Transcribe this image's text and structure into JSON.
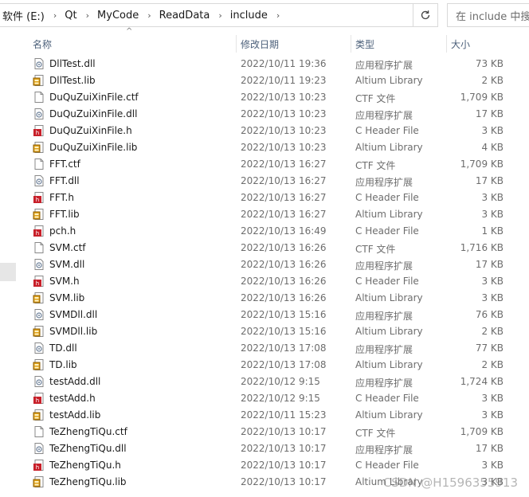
{
  "breadcrumb": [
    "软件 (E:)",
    "Qt",
    "MyCode",
    "ReadData",
    "include"
  ],
  "search": {
    "placeholder": "在 include 中搜索"
  },
  "columns": {
    "name": "名称",
    "date": "修改日期",
    "type": "类型",
    "size": "大小"
  },
  "files": [
    {
      "name": "DllTest.dll",
      "date": "2022/10/11 19:36",
      "type": "应用程序扩展",
      "size": "73 KB",
      "icon": "dll-icon"
    },
    {
      "name": "DllTest.lib",
      "date": "2022/10/11 19:23",
      "type": "Altium Library",
      "size": "2 KB",
      "icon": "lib-icon"
    },
    {
      "name": "DuQuZuiXinFile.ctf",
      "date": "2022/10/13 10:23",
      "type": "CTF 文件",
      "size": "1,709 KB",
      "icon": "file-icon"
    },
    {
      "name": "DuQuZuiXinFile.dll",
      "date": "2022/10/13 10:23",
      "type": "应用程序扩展",
      "size": "17 KB",
      "icon": "dll-icon"
    },
    {
      "name": "DuQuZuiXinFile.h",
      "date": "2022/10/13 10:23",
      "type": "C Header File",
      "size": "3 KB",
      "icon": "header-icon"
    },
    {
      "name": "DuQuZuiXinFile.lib",
      "date": "2022/10/13 10:23",
      "type": "Altium Library",
      "size": "4 KB",
      "icon": "lib-icon"
    },
    {
      "name": "FFT.ctf",
      "date": "2022/10/13 16:27",
      "type": "CTF 文件",
      "size": "1,709 KB",
      "icon": "file-icon"
    },
    {
      "name": "FFT.dll",
      "date": "2022/10/13 16:27",
      "type": "应用程序扩展",
      "size": "17 KB",
      "icon": "dll-icon"
    },
    {
      "name": "FFT.h",
      "date": "2022/10/13 16:27",
      "type": "C Header File",
      "size": "3 KB",
      "icon": "header-icon"
    },
    {
      "name": "FFT.lib",
      "date": "2022/10/13 16:27",
      "type": "Altium Library",
      "size": "3 KB",
      "icon": "lib-icon"
    },
    {
      "name": "pch.h",
      "date": "2022/10/13 16:49",
      "type": "C Header File",
      "size": "1 KB",
      "icon": "header-icon"
    },
    {
      "name": "SVM.ctf",
      "date": "2022/10/13 16:26",
      "type": "CTF 文件",
      "size": "1,716 KB",
      "icon": "file-icon"
    },
    {
      "name": "SVM.dll",
      "date": "2022/10/13 16:26",
      "type": "应用程序扩展",
      "size": "17 KB",
      "icon": "dll-icon"
    },
    {
      "name": "SVM.h",
      "date": "2022/10/13 16:26",
      "type": "C Header File",
      "size": "3 KB",
      "icon": "header-icon"
    },
    {
      "name": "SVM.lib",
      "date": "2022/10/13 16:26",
      "type": "Altium Library",
      "size": "3 KB",
      "icon": "lib-icon"
    },
    {
      "name": "SVMDll.dll",
      "date": "2022/10/13 15:16",
      "type": "应用程序扩展",
      "size": "76 KB",
      "icon": "dll-icon"
    },
    {
      "name": "SVMDll.lib",
      "date": "2022/10/13 15:16",
      "type": "Altium Library",
      "size": "2 KB",
      "icon": "lib-icon"
    },
    {
      "name": "TD.dll",
      "date": "2022/10/13 17:08",
      "type": "应用程序扩展",
      "size": "77 KB",
      "icon": "dll-icon"
    },
    {
      "name": "TD.lib",
      "date": "2022/10/13 17:08",
      "type": "Altium Library",
      "size": "2 KB",
      "icon": "lib-icon"
    },
    {
      "name": "testAdd.dll",
      "date": "2022/10/12 9:15",
      "type": "应用程序扩展",
      "size": "1,724 KB",
      "icon": "dll-icon"
    },
    {
      "name": "testAdd.h",
      "date": "2022/10/12 9:15",
      "type": "C Header File",
      "size": "3 KB",
      "icon": "header-icon"
    },
    {
      "name": "testAdd.lib",
      "date": "2022/10/11 15:23",
      "type": "Altium Library",
      "size": "3 KB",
      "icon": "lib-icon"
    },
    {
      "name": "TeZhengTiQu.ctf",
      "date": "2022/10/13 10:17",
      "type": "CTF 文件",
      "size": "1,709 KB",
      "icon": "file-icon"
    },
    {
      "name": "TeZhengTiQu.dll",
      "date": "2022/10/13 10:17",
      "type": "应用程序扩展",
      "size": "17 KB",
      "icon": "dll-icon"
    },
    {
      "name": "TeZhengTiQu.h",
      "date": "2022/10/13 10:17",
      "type": "C Header File",
      "size": "3 KB",
      "icon": "header-icon"
    },
    {
      "name": "TeZhengTiQu.lib",
      "date": "2022/10/13 10:17",
      "type": "Altium Library",
      "size": "3 KB",
      "icon": "lib-icon"
    }
  ],
  "watermark": "CSDN @H1596355913",
  "colors": {
    "header_text": "#4c607a",
    "secondary_text": "#6d6d6d",
    "header_icon_red": "#c8202a",
    "lib_icon_gold": "#e0a21b"
  }
}
